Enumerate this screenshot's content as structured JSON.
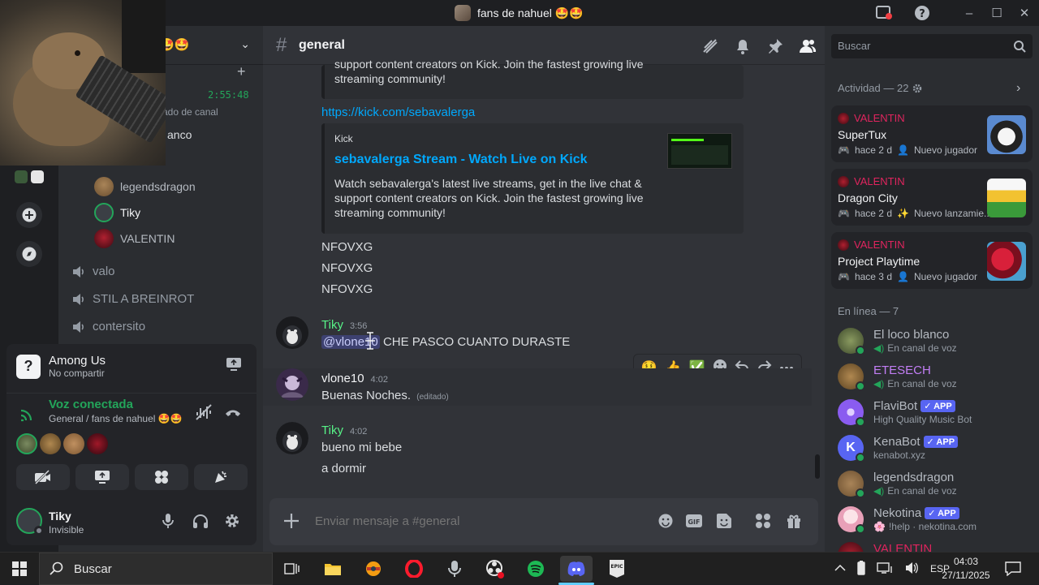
{
  "window": {
    "title": "fans de nahuel 🤩🤩",
    "controls": {
      "inbox": "inbox-icon",
      "help": "?",
      "minimize": "–",
      "maximize": "☐",
      "close": "✕"
    }
  },
  "server": {
    "name_tail": "🤩🤩",
    "chevron": "⌄"
  },
  "channels": {
    "add": "+",
    "timer": "2:55:48",
    "partial_status": "ado de canal",
    "partial_user": "anco",
    "voice_users": [
      {
        "name": "legendsdragon"
      },
      {
        "name": "Tiky"
      },
      {
        "name": "VALENTIN"
      }
    ],
    "voice_channels": [
      {
        "name": "valo"
      },
      {
        "name": "STIL A BREINROT"
      },
      {
        "name": "contersito"
      }
    ]
  },
  "activity_panel": {
    "game": "Among Us",
    "share_status": "No compartir",
    "voice_title": "Voz conectada",
    "voice_location": "General / fans de nahuel 🤩🤩"
  },
  "user_bar": {
    "name": "Tiky",
    "status": "Invisible"
  },
  "chat": {
    "channel": "general",
    "embed1_tail_line1": "support content creators on Kick. Join the fastest growing live",
    "embed1_tail_line2": "streaming community!",
    "link": "https://kick.com/sebavalerga",
    "embed2": {
      "provider": "Kick",
      "title": "sebavalerga Stream - Watch Live on Kick",
      "desc1": "Watch sebavalerga's latest live streams, get in the live chat &",
      "desc2": "support content creators on Kick. Join the fastest growing live",
      "desc3": "streaming community!"
    },
    "spam": [
      "NFOVXG",
      "NFOVXG",
      "NFOVXG"
    ],
    "messages": [
      {
        "author": "Tiky",
        "time": "3:56",
        "mention": "@vlone10",
        "text": " CHE PASCO CUANTO DURASTE",
        "color": "#57f287"
      },
      {
        "author": "vlone10",
        "time": "4:02",
        "text": "Buenas Noches.",
        "edited": "(editado)",
        "color": "#f2f3f5"
      },
      {
        "author": "Tiky",
        "time": "4:02",
        "lines": [
          "bueno mi bebe",
          "a dormir"
        ],
        "color": "#57f287"
      }
    ],
    "reactions": [
      "🤑",
      "👍",
      "✅"
    ],
    "composer_placeholder": "Enviar mensaje a #general"
  },
  "members_panel": {
    "search_placeholder": "Buscar",
    "activity_header": "Actividad — 22",
    "activities": [
      {
        "user": "VALENTIN",
        "game": "SuperTux",
        "time": "hace 2 d",
        "tag": "Nuevo jugador"
      },
      {
        "user": "VALENTIN",
        "game": "Dragon City",
        "time": "hace 2 d",
        "tag": "Nuevo lanzamie..."
      },
      {
        "user": "VALENTIN",
        "game": "Project Playtime",
        "time": "hace 3 d",
        "tag": "Nuevo jugador"
      }
    ],
    "online_header": "En línea — 7",
    "members": [
      {
        "name": "El loco blanco",
        "sub": "En canal de voz",
        "color": "#b5bac1"
      },
      {
        "name": "ETESECH",
        "sub": "En canal de voz",
        "color": "#c27ef5"
      },
      {
        "name": "FlaviBot",
        "app": "APP",
        "sub": "High Quality Music Bot",
        "color": "#b5bac1"
      },
      {
        "name": "KenaBot",
        "app": "APP",
        "sub": "kenabot.xyz",
        "color": "#b5bac1"
      },
      {
        "name": "legendsdragon",
        "sub": "En canal de voz",
        "color": "#b5bac1"
      },
      {
        "name": "Nekotina",
        "app": "APP",
        "sub": "!help · nekotina.com",
        "color": "#b5bac1"
      },
      {
        "name": "VALENTIN",
        "sub": "",
        "color": "#e0245e"
      }
    ]
  },
  "taskbar": {
    "search": "Buscar",
    "lang": "ESP",
    "time": "04:03",
    "date": "27/11/2025"
  }
}
